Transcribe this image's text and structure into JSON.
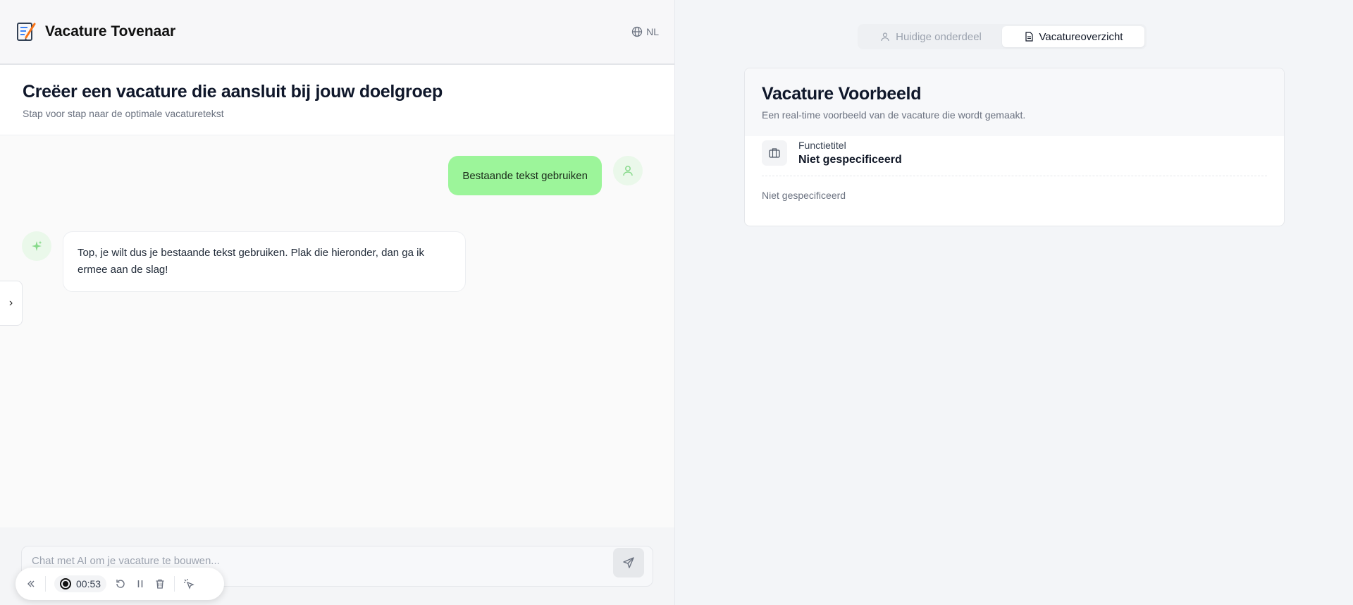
{
  "app": {
    "title": "Vacature Tovenaar",
    "language": "NL"
  },
  "header": {
    "title": "Creëer een vacature die aansluit bij jouw doelgroep",
    "subtitle": "Stap voor stap naar de optimale vacaturetekst"
  },
  "chat": {
    "messages": [
      {
        "role": "user",
        "text": "Bestaande tekst gebruiken"
      },
      {
        "role": "assistant",
        "text": "Top, je wilt dus je bestaande tekst gebruiken. Plak die hieronder, dan ga ik ermee aan de slag!"
      }
    ],
    "input_placeholder": "Chat met AI om je vacature te bouwen..."
  },
  "recorder": {
    "time": "00:53"
  },
  "tabs": [
    {
      "label": "Huidige onderdeel",
      "active": false
    },
    {
      "label": "Vacatureoverzicht",
      "active": true
    }
  ],
  "preview": {
    "title": "Vacature Voorbeeld",
    "subtitle": "Een real-time voorbeeld van de vacature die wordt gemaakt.",
    "field_label": "Functietitel",
    "field_value": "Niet gespecificeerd",
    "description": "Niet gespecificeerd"
  },
  "colors": {
    "user_bubble": "#9cf59a",
    "accent_green": "#4ade80"
  }
}
